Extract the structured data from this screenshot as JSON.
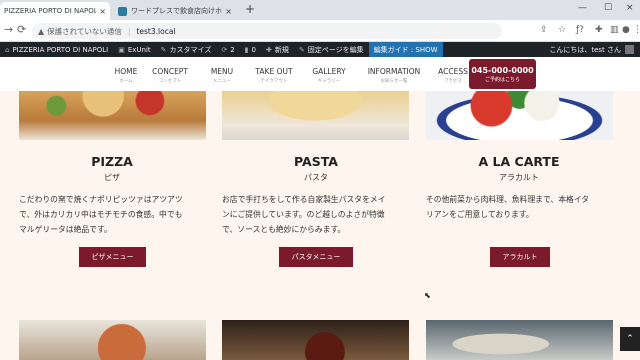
{
  "browser": {
    "tabs": [
      {
        "title": "PIZZERIA PORTO DI NAPOLI | 本"
      },
      {
        "title": "ワードプレスで飲食店向けホームペー"
      }
    ],
    "address": {
      "security_label": "保護されていない通信",
      "url": "test3.local"
    },
    "icons": {
      "close": "×",
      "new_tab": "+",
      "minimize": "—",
      "maximize": "☐",
      "back": "←",
      "forward": "→",
      "reload": "⟳",
      "warn": "▲",
      "share": "⇪",
      "star": "☆",
      "extensions": "✚",
      "sidebar": "▥",
      "profile": "●",
      "menu": "⋮",
      "font": "ƒ?"
    }
  },
  "admin_bar": {
    "site_name": "PIZZERIA PORTO DI NAPOLI",
    "exunit": "ExUnit",
    "customize": "カスタマイズ",
    "updates_count": "2",
    "comments_count": "0",
    "new": "新規",
    "edit_page": "固定ページを編集",
    "guide": "編集ガイド : SHOW",
    "greeting": "こんにちは、test さん"
  },
  "nav": {
    "items": [
      {
        "en": "HOME",
        "ja": "ホーム"
      },
      {
        "en": "CONCEPT",
        "ja": "コンセプト"
      },
      {
        "en": "MENU",
        "ja": "メニュー"
      },
      {
        "en": "TAKE OUT",
        "ja": "テイクアウト"
      },
      {
        "en": "GALLERY",
        "ja": "ギャラリー"
      },
      {
        "en": "INFORMATION",
        "ja": "お知らせ一覧"
      },
      {
        "en": "ACCESS",
        "ja": "アクセス"
      }
    ],
    "reserve": {
      "phone": "045-000-0000",
      "label": "ご予約はこちら"
    }
  },
  "cards": [
    {
      "title": "PIZZA",
      "subtitle": "ピザ",
      "lines": [
        "こだわりの窯で焼くナポリピッツァはアツアツ",
        "で、外はカリカリ中はモチモチの食感。中でも",
        "マルゲリータは絶品です。"
      ],
      "button": "ピザメニュー"
    },
    {
      "title": "PASTA",
      "subtitle": "パスタ",
      "lines": [
        "お店で手打ちをして作る自家製生パスタをメイ",
        "ンにご提供しています。のど越しのよさが特徴",
        "で、ソースとも絶妙にからみます。"
      ],
      "button": "パスタメニュー"
    },
    {
      "title": "A LA CARTE",
      "subtitle": "アラカルト",
      "lines": [
        "その他前菜から肉料理、魚料理まで、本格イタ",
        "リアンをご用意しております。"
      ],
      "button": "アラカルト"
    }
  ],
  "ui": {
    "page_top": "⌃",
    "cursor": "⬉"
  }
}
